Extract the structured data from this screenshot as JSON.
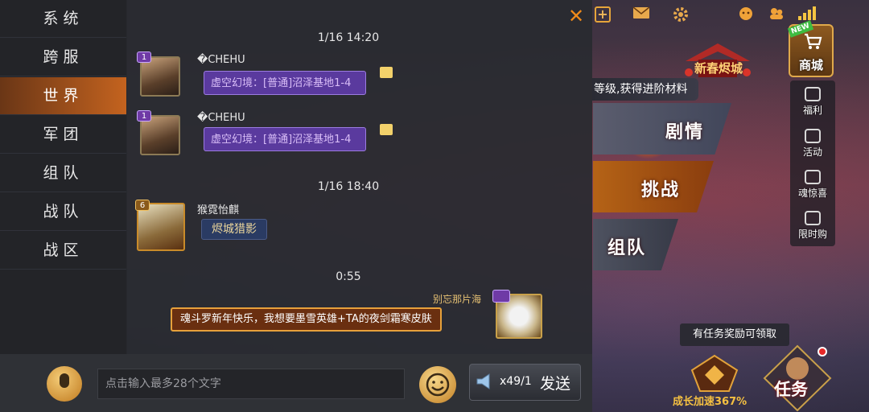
{
  "tabs": [
    "系统",
    "跨服",
    "世界",
    "军团",
    "组队",
    "战队",
    "战区"
  ],
  "active_tab_index": 2,
  "chat": {
    "messages": [
      {
        "timestamp": "1/16  14:20",
        "level": "1",
        "user": "�CHEHU",
        "text": "虚空幻境：[普通]沼泽基地1-4"
      },
      {
        "level": "1",
        "user": "�CHEHU",
        "text": "虚空幻境：[普通]沼泽基地1-4"
      },
      {
        "timestamp": "1/16  18:40",
        "level": "6",
        "user": "猴霓怡麒",
        "text": "烬城猎影"
      },
      {
        "timestamp": "0:55",
        "user": "别忘那片海",
        "text": "魂斗罗新年快乐，我想要墨雪英雄+TA的夜剑霜寒皮肤"
      }
    ]
  },
  "input": {
    "placeholder": "点击输入最多28个文字"
  },
  "send": {
    "count": "x49/1",
    "label": "发送"
  },
  "game": {
    "new_year_label": "新春烬城",
    "shop": {
      "label": "商城",
      "new_badge": "NEW"
    },
    "side_menu": [
      "福利",
      "活动",
      "魂惊喜",
      "限时购"
    ],
    "quest_tip": "等级,获得进阶材料",
    "modes": [
      "剧情",
      "挑战",
      "组队"
    ],
    "reward_tip": "有任务奖励可领取",
    "growth": "成长加速367%",
    "mission": "任务"
  },
  "colors": {
    "accent": "#c4631f",
    "close": "#f08a1a",
    "bubble_purple": "#5a3a9e",
    "gold": "#f5c041"
  }
}
